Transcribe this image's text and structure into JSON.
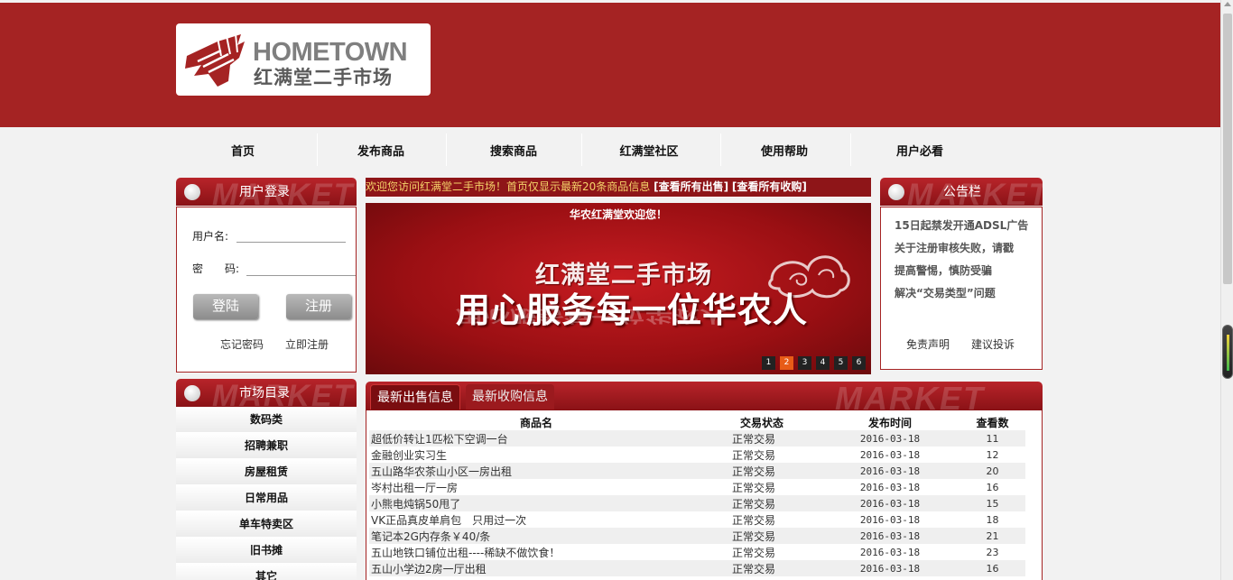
{
  "logo": {
    "en": "HOMETOWN",
    "cn": "红满堂二手市场"
  },
  "nav": [
    "首页",
    "发布商品",
    "搜索商品",
    "红满堂社区",
    "使用帮助",
    "用户必看"
  ],
  "login": {
    "title": "用户登录",
    "watermark": "MARKET",
    "username_label": "用户名:",
    "password_label": "密　　码:",
    "login_button": "登陆",
    "register_button": "注册",
    "forgot_link": "忘记密码",
    "signup_link": "立即注册"
  },
  "marquee": {
    "text": "欢迎您访问红满堂二手市场！首页仅显示最新20条商品信息",
    "link_sales": "[查看所有出售]",
    "link_wanted": "[查看所有收购]"
  },
  "banner": {
    "welcome": "华农红满堂欢迎您！",
    "line1": "红满堂二手市场",
    "line2": "用心服务每一位华农人",
    "pages": [
      "1",
      "2",
      "3",
      "4",
      "5",
      "6"
    ],
    "active_page": "2"
  },
  "notice": {
    "title": "公告栏",
    "watermark": "MARKET",
    "items": [
      "15日起禁发开通ADSL广告",
      "关于注册审核失败，请戳",
      "提高警惕，慎防受骗",
      "解决“交易类型”问题"
    ],
    "disclaimer": "免责声明",
    "complaint": "建议投诉"
  },
  "categories": {
    "title": "市场目录",
    "watermark": "MARKET",
    "items": [
      "数码类",
      "招聘兼职",
      "房屋租赁",
      "日常用品",
      "单车特卖区",
      "旧书摊",
      "其它"
    ]
  },
  "listing": {
    "tab_sale": "最新出售信息",
    "tab_buy": "最新收购信息",
    "watermark": "MARKET",
    "headers": [
      "商品名",
      "交易状态",
      "发布时间",
      "查看数"
    ],
    "rows": [
      [
        "超低价转让1匹松下空调一台",
        "正常交易",
        "2016-03-18",
        "11"
      ],
      [
        "金融创业实习生",
        "正常交易",
        "2016-03-18",
        "12"
      ],
      [
        "五山路华农茶山小区一房出租",
        "正常交易",
        "2016-03-18",
        "20"
      ],
      [
        "岑村出租一厅一房",
        "正常交易",
        "2016-03-18",
        "16"
      ],
      [
        "小熊电炖锅50甩了",
        "正常交易",
        "2016-03-18",
        "15"
      ],
      [
        "VK正品真皮单肩包　只用过一次",
        "正常交易",
        "2016-03-18",
        "18"
      ],
      [
        "笔记本2G内存条￥40/条",
        "正常交易",
        "2016-03-18",
        "21"
      ],
      [
        "五山地铁口铺位出租----稀缺不做饮食！",
        "正常交易",
        "2016-03-18",
        "23"
      ],
      [
        "五山小学边2房一厅出租",
        "正常交易",
        "2016-03-18",
        "16"
      ]
    ]
  },
  "colors": {
    "brand": "#a52323",
    "accent": "#e85c17"
  }
}
